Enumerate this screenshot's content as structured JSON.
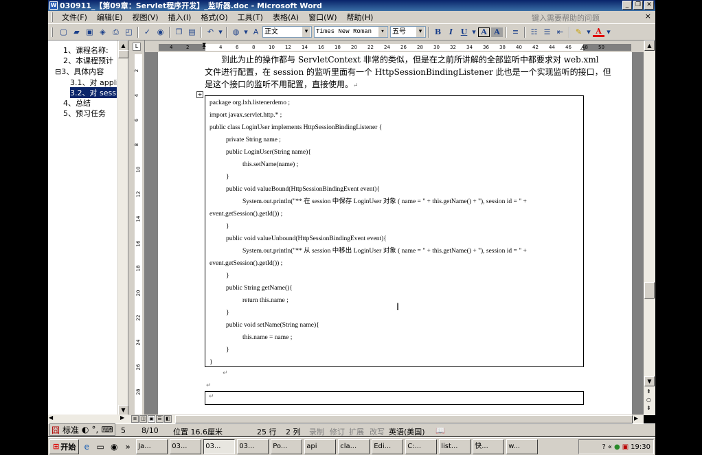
{
  "window": {
    "title": "030911_【第09章：Servlet程序开发】_监听器.doc - Microsoft Word",
    "app_icon": "W",
    "minimize": "_",
    "restore": "❐",
    "close": "✕"
  },
  "menu": {
    "items": [
      "文件(F)",
      "编辑(E)",
      "视图(V)",
      "插入(I)",
      "格式(O)",
      "工具(T)",
      "表格(A)",
      "窗口(W)",
      "帮助(H)"
    ],
    "help_placeholder": "键入需要帮助的问题",
    "close_glyph": "×"
  },
  "toolbar": {
    "style": "正文",
    "font": "Times New Roman",
    "size": "五号",
    "bold": "B",
    "italic": "I",
    "underline": "U",
    "char_border": "A",
    "char_shade": "A",
    "font_color": "A"
  },
  "doc_map": {
    "items": [
      {
        "label": "1、课程名称:",
        "selected": false
      },
      {
        "label": "2、本课程预计",
        "selected": false
      },
      {
        "label": "⊟3、具体内容",
        "selected": false
      },
      {
        "label": "3.1、对 applic",
        "selected": false
      },
      {
        "label": "3.2、对 sessio",
        "selected": true
      },
      {
        "label": "4、总结",
        "selected": false
      },
      {
        "label": "5、预习任务",
        "selected": false
      }
    ]
  },
  "ruler": {
    "h_numbers": [
      "4",
      "2",
      "2",
      "4",
      "6",
      "8",
      "10",
      "12",
      "14",
      "16",
      "18",
      "20",
      "22",
      "24",
      "26",
      "28",
      "30",
      "32",
      "34",
      "36",
      "38",
      "40",
      "42",
      "44",
      "46",
      "48",
      "50"
    ],
    "v_numbers": [
      "2",
      "4",
      "6",
      "8",
      "10",
      "12",
      "14",
      "16",
      "18",
      "20",
      "22",
      "24",
      "26",
      "28"
    ],
    "tab_selector": "L"
  },
  "document": {
    "paragraph": [
      "到此为止的操作都与 ServletContext 非常的类似，但是在之前所讲解的全部监听中都要求对 web.xml",
      "文件进行配置，在 session 的监听里面有一个 HttpSessionBindingListener 此也是一个实现监听的接口，但",
      "是这个接口的监听不用配置，直接使用。"
    ],
    "code_lines": [
      "package org.lxh.listenerdemo ;",
      "import javax.servlet.http.* ;",
      "public class LoginUser implements HttpSessionBindingListener {",
      "private String name ;",
      "public LoginUser(String name){",
      "this.setName(name) ;",
      "}",
      "public void valueBound(HttpSessionBindingEvent event){",
      "System.out.println(\"** 在 session 中保存 LoginUser 对象 ( name = \" + this.getName() + \"), session id = \" +",
      "event.getSession().getId()) ;",
      "}",
      "public void valueUnbound(HttpSessionBindingEvent event){",
      "System.out.println(\"** 从 session 中移出 LoginUser 对象 ( name = \" + this.getName() + \"), session id = \" +",
      "event.getSession().getId()) ;",
      "}",
      "public String getName(){",
      "return this.name ;",
      "}",
      "public void setName(String name){",
      "this.name = name ;",
      "}",
      "}"
    ],
    "para_mark": "↵",
    "table_anchor": "+"
  },
  "status": {
    "page": "5",
    "section": "8/10",
    "position": "位置 16.6厘米",
    "line": "25 行",
    "column": "2 列",
    "rec": "录制",
    "trk": "修订",
    "ext": "扩展",
    "ovr": "改写",
    "language": "英语(美国)",
    "ime_label": "标准"
  },
  "taskbar": {
    "start": "开始",
    "chevron": "»",
    "tasks": [
      "Ja...",
      "03...",
      "03...",
      "03...",
      "Po...",
      "api",
      "cla...",
      "Edi...",
      "C:...",
      "list...",
      "快...",
      "w..."
    ],
    "active_index": 2,
    "tray_chevron": "«",
    "clock": "19:30"
  }
}
